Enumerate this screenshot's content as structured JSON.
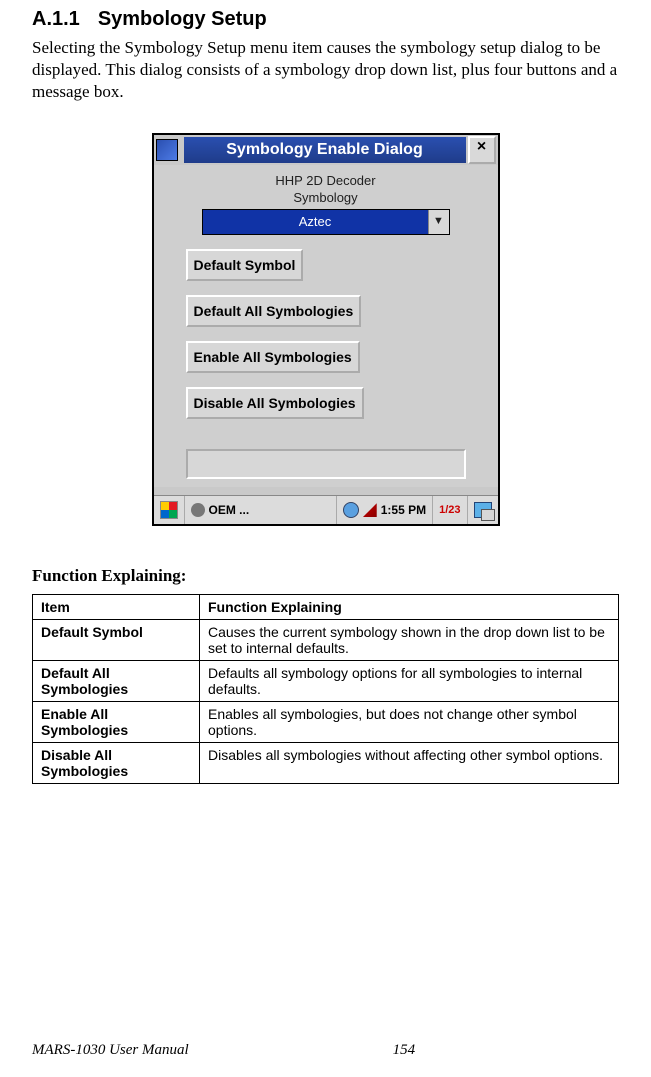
{
  "section": {
    "number": "A.1.1",
    "title": "Symbology Setup"
  },
  "intro": "Selecting the Symbology Setup menu item causes the symbology setup dialog to be displayed. This dialog consists of a symbology drop down list, plus four buttons and a message box.",
  "dialog": {
    "title": "Symbology Enable Dialog",
    "app_header": "HHP 2D Decoder",
    "group_label": "Symbology",
    "combo_selected": "Aztec",
    "buttons": {
      "default_symbol": "Default Symbol",
      "default_all": "Default All Symbologies",
      "enable_all": "Enable All Symbologies",
      "disable_all": "Disable All Symbologies"
    },
    "taskbar": {
      "task_label": "OEM ...",
      "clock": "1:55 PM",
      "date_abbrev": "1/23"
    }
  },
  "func_heading": "Function Explaining:",
  "table": {
    "headers": {
      "item": "Item",
      "desc": "Function Explaining"
    },
    "rows": [
      {
        "item": "Default Symbol",
        "desc": "Causes the current symbology shown in the drop down list to be set to internal defaults."
      },
      {
        "item": "Default All Symbologies",
        "desc": "Defaults all symbology options for all symbologies to internal defaults."
      },
      {
        "item": "Enable All Symbologies",
        "desc": "Enables all symbologies, but does not change other symbol options."
      },
      {
        "item": "Disable All Symbologies",
        "desc": "Disables all symbologies without affecting other symbol options."
      }
    ]
  },
  "footer": {
    "manual": "MARS-1030 User Manual",
    "page": "154"
  }
}
